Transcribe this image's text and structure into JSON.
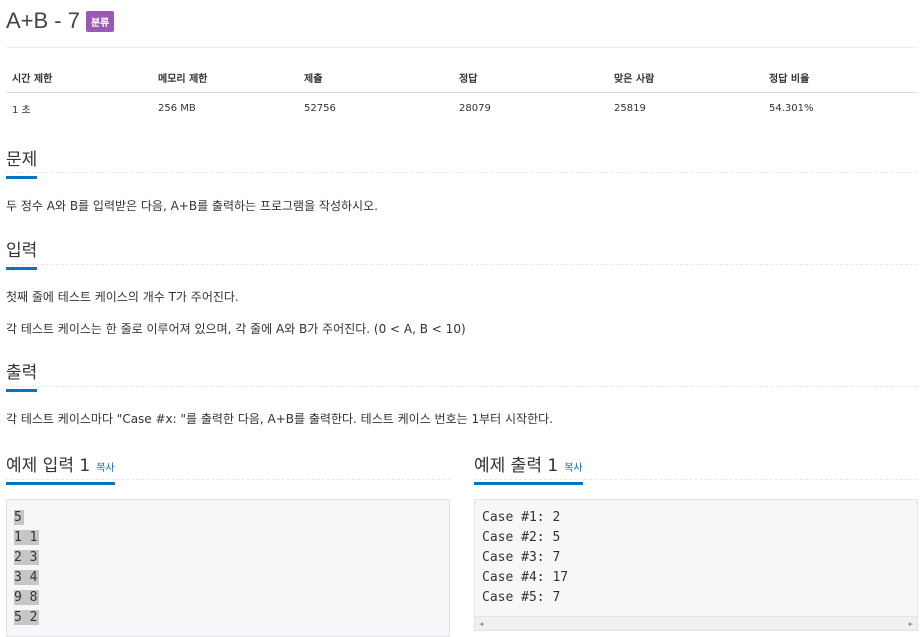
{
  "problem": {
    "title": "A+B - 7",
    "badge": "분류"
  },
  "stats": {
    "headers": [
      "시간 제한",
      "메모리 제한",
      "제출",
      "정답",
      "맞은 사람",
      "정답 비율"
    ],
    "values": [
      "1 초",
      "256 MB",
      "52756",
      "28079",
      "25819",
      "54.301%"
    ]
  },
  "sections": {
    "problem_heading": "문제",
    "problem_text": "두 정수 A와 B를 입력받은 다음, A+B를 출력하는 프로그램을 작성하시오.",
    "input_heading": "입력",
    "input_text_1": "첫째 줄에 테스트 케이스의 개수 T가 주어진다.",
    "input_text_2": "각 테스트 케이스는 한 줄로 이루어져 있으며, 각 줄에 A와 B가 주어진다. (0 < A, B < 10)",
    "output_heading": "출력",
    "output_text": "각 테스트 케이스마다 \"Case #x: \"를 출력한 다음, A+B를 출력한다. 테스트 케이스 번호는 1부터 시작한다."
  },
  "samples": {
    "input_heading": "예제 입력 1",
    "output_heading": "예제 출력 1",
    "copy_label": "복사",
    "input_lines": [
      "5",
      "1 1",
      "2 3",
      "3 4",
      "9 8",
      "5 2"
    ],
    "output_lines": [
      "Case #1: 2",
      "Case #2: 5",
      "Case #3: 7",
      "Case #4: 17",
      "Case #5: 7"
    ]
  },
  "colors": {
    "accent": "#0076c0",
    "badge": "#9b59b6"
  }
}
